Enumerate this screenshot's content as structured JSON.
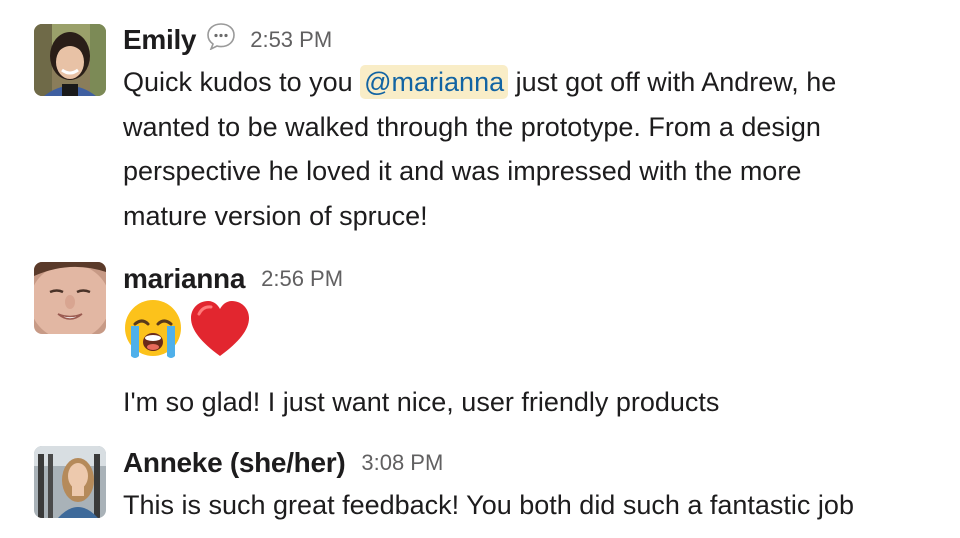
{
  "messages": [
    {
      "sender": "Emily",
      "time": "2:53 PM",
      "status_icon": "speech-bubble-icon",
      "text_before": "Quick kudos to you ",
      "mention": "@marianna",
      "text_after": " just got off with Andrew, he",
      "lines": [
        "wanted to be walked through the prototype. From a design",
        "perspective he loved it and was impressed with the more",
        "mature version of spruce!"
      ]
    },
    {
      "sender": "marianna",
      "time": "2:56 PM",
      "emojis": [
        "loudly-crying-face-icon",
        "red-heart-icon"
      ],
      "text": "I'm so glad! I just want nice, user friendly products"
    },
    {
      "sender": "Anneke (she/her)",
      "time": "3:08 PM",
      "text": "This is such great feedback! You both did such a fantastic job"
    }
  ],
  "colors": {
    "mention_bg": "#f9edc7",
    "mention_text": "#1264a3",
    "timestamp": "#616061",
    "text": "#1d1c1d"
  }
}
